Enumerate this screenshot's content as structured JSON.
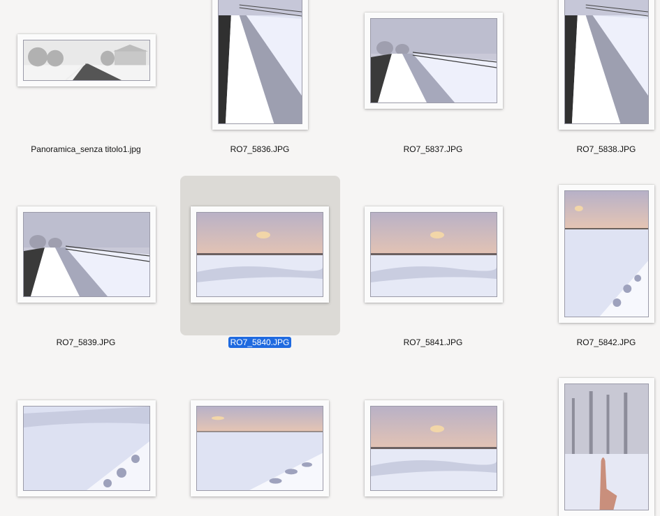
{
  "files": [
    {
      "name": "Panoramica_senza titolo1.jpg",
      "scene": "foggy-road",
      "selected": false
    },
    {
      "name": "RO7_5836.JPG",
      "scene": "snow-ditch",
      "selected": false
    },
    {
      "name": "RO7_5837.JPG",
      "scene": "fog-road-vineyard",
      "selected": false
    },
    {
      "name": "RO7_5838.JPG",
      "scene": "snow-ditch",
      "selected": false
    },
    {
      "name": "RO7_5839.JPG",
      "scene": "fog-road-vineyard",
      "selected": false
    },
    {
      "name": "RO7_5840.JPG",
      "scene": "sunset-field",
      "selected": true
    },
    {
      "name": "RO7_5841.JPG",
      "scene": "sunset-field",
      "selected": false
    },
    {
      "name": "RO7_5842.JPG",
      "scene": "sunset-field-bank",
      "selected": false
    },
    {
      "name": "",
      "scene": "snow-bank",
      "selected": false
    },
    {
      "name": "",
      "scene": "sunset-field-bank",
      "selected": false
    },
    {
      "name": "",
      "scene": "sunset-field",
      "selected": false
    },
    {
      "name": "",
      "scene": "finger-trees",
      "selected": false
    }
  ],
  "colors": {
    "background": "#f6f5f4",
    "selection_background": "#dcdad6",
    "selected_label": "#1f6ae0"
  }
}
